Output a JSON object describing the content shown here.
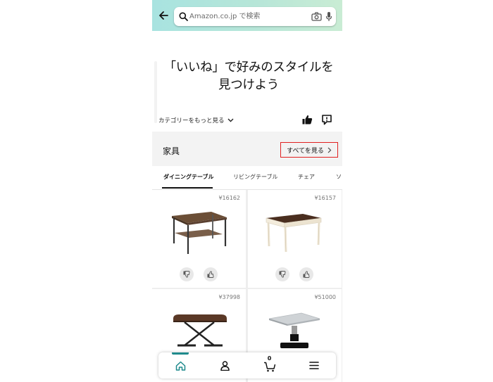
{
  "search": {
    "placeholder": "Amazon.co.jp で検索"
  },
  "hero": {
    "title_line1": "「いいね」で好みのスタイルを",
    "title_line2": "見つけよう"
  },
  "more_categories_label": "カテゴリーをもっと見る",
  "category": {
    "title": "家具",
    "see_all_label": "すべてを見る"
  },
  "tabs": [
    {
      "label": "ダイニングテーブル",
      "active": true
    },
    {
      "label": "リビングテーブル",
      "active": false
    },
    {
      "label": "チェア",
      "active": false
    },
    {
      "label": "ソ",
      "active": false
    }
  ],
  "products": [
    {
      "price": "¥16162",
      "kind": "industrial-dining-table"
    },
    {
      "price": "¥16157",
      "kind": "white-leg-dining-table"
    },
    {
      "price": "¥37998",
      "kind": "lift-coffee-table"
    },
    {
      "price": "¥51000",
      "kind": "pedestal-table"
    }
  ],
  "bottom_nav": {
    "cart_count": "0"
  },
  "colors": {
    "accent": "#1f8a8c",
    "highlight_border": "#e02020"
  },
  "icons": [
    "back-arrow-icon",
    "search-icon",
    "camera-icon",
    "microphone-icon",
    "chevron-down-icon",
    "thumbs-up-icon",
    "feedback-icon",
    "chevron-right-icon",
    "thumbs-down-icon",
    "home-icon",
    "account-icon",
    "cart-icon",
    "menu-icon"
  ]
}
